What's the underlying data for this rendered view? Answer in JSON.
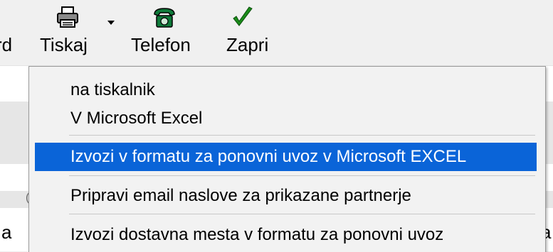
{
  "toolbar": {
    "partial_label": "rd",
    "print": {
      "label": "Tiskaj",
      "icon": "printer-icon"
    },
    "phone": {
      "label": "Telefon",
      "icon": "telephone-icon",
      "color": "#0f7a3a"
    },
    "close": {
      "label": "Zapri",
      "icon": "checkmark-icon",
      "color": "#1a8c1a"
    }
  },
  "background": {
    "left_cell_text": "a",
    "left_small_text": "(",
    "right_cell_text": "a"
  },
  "menu": {
    "items": [
      {
        "label": "na tiskalnik"
      },
      {
        "label": "V Microsoft Excel"
      },
      {
        "label": "Izvozi v formatu za ponovni uvoz v Microsoft EXCEL",
        "selected": true
      },
      {
        "label": "Pripravi email naslove za prikazane partnerje"
      },
      {
        "label": "Izvozi dostavna mesta v formatu za ponovni uvoz"
      }
    ],
    "highlight_color": "#0a64d8"
  }
}
